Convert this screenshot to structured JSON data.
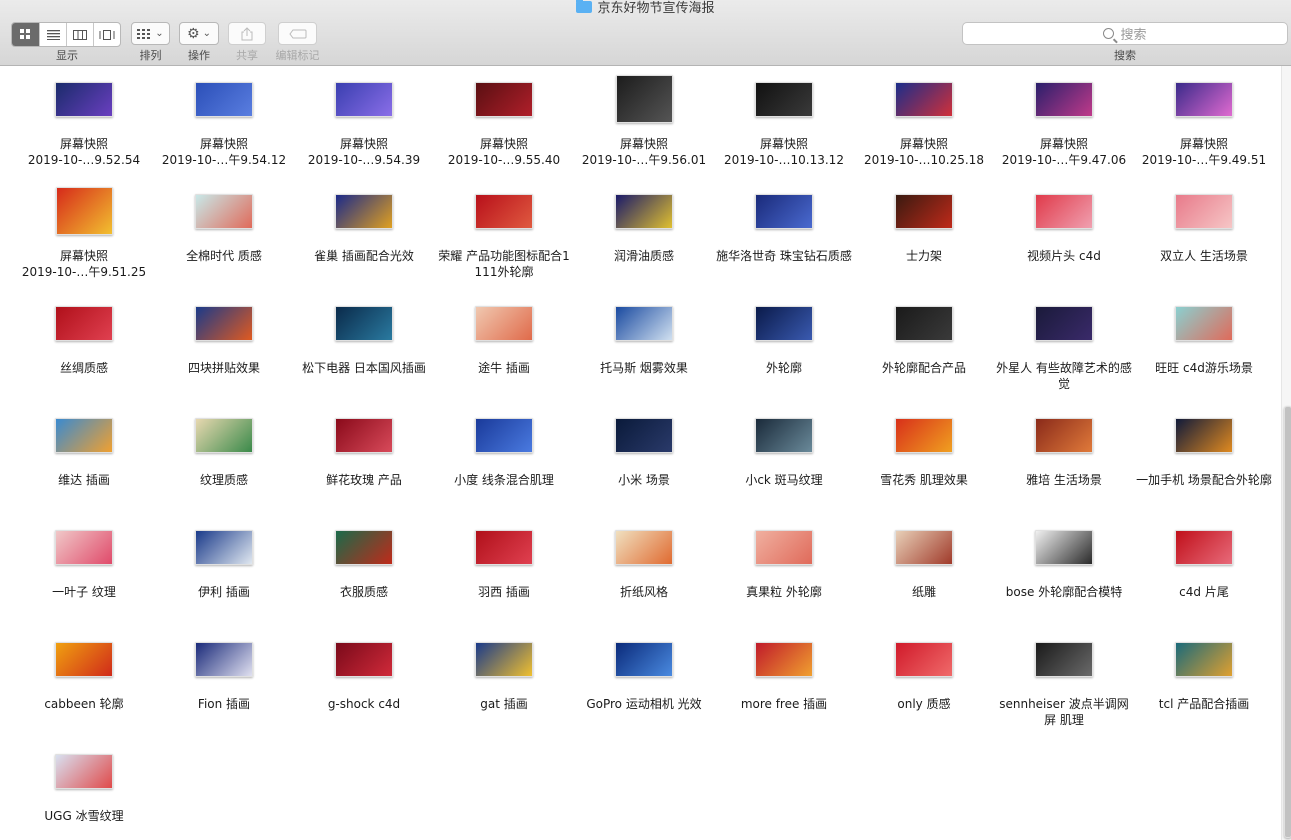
{
  "window": {
    "title": "京东好物节宣传海报"
  },
  "toolbar": {
    "view_label": "显示",
    "arrange_label": "排列",
    "action_label": "操作",
    "share_label": "共享",
    "tags_label": "编辑标记",
    "search_placeholder": "搜索",
    "search_label": "搜索"
  },
  "items": [
    {
      "name": "屏幕快照\n2019-10-…9.52.54",
      "colors": [
        "#1a2b6b",
        "#6a3fc0"
      ]
    },
    {
      "name": "屏幕快照\n2019-10-…午9.54.12",
      "colors": [
        "#2b4fb8",
        "#5a7ee0"
      ]
    },
    {
      "name": "屏幕快照\n2019-10-…9.54.39",
      "colors": [
        "#3a3fb0",
        "#8a6ee8"
      ]
    },
    {
      "name": "屏幕快照\n2019-10-…9.55.40",
      "colors": [
        "#5a0f12",
        "#b01f2a"
      ]
    },
    {
      "name": "屏幕快照\n2019-10-…午9.56.01",
      "colors": [
        "#1c1c1c",
        "#555555"
      ],
      "tall": true
    },
    {
      "name": "屏幕快照\n2019-10-…10.13.12",
      "colors": [
        "#111111",
        "#3a3a3a"
      ]
    },
    {
      "name": "屏幕快照\n2019-10-…10.25.18",
      "colors": [
        "#1b2d8a",
        "#d0303a"
      ]
    },
    {
      "name": "屏幕快照\n2019-10-…午9.47.06",
      "colors": [
        "#2a1f6b",
        "#c03a8a"
      ]
    },
    {
      "name": "屏幕快照\n2019-10-…午9.49.51",
      "colors": [
        "#3a2a8a",
        "#e06ad0"
      ]
    },
    {
      "name": "屏幕快照\n2019-10-…午9.51.25",
      "colors": [
        "#d62a1a",
        "#f2c030"
      ],
      "tall": true
    },
    {
      "name": "全棉时代 质感",
      "colors": [
        "#c8e8e8",
        "#e06a5a"
      ]
    },
    {
      "name": "雀巢 插画配合光效",
      "colors": [
        "#1b2a8a",
        "#e0a020"
      ]
    },
    {
      "name": "荣耀 产品功能图标配合1111外轮廓",
      "colors": [
        "#b8101a",
        "#e05a40"
      ]
    },
    {
      "name": "润滑油质感",
      "colors": [
        "#1a1a6a",
        "#e0c030"
      ]
    },
    {
      "name": "施华洛世奇 珠宝钻石质感",
      "colors": [
        "#1a2a7a",
        "#4a6ad0"
      ]
    },
    {
      "name": "士力架",
      "colors": [
        "#3a1a10",
        "#c02a1a"
      ]
    },
    {
      "name": "视频片头 c4d",
      "colors": [
        "#e03a4a",
        "#f0a0b0"
      ]
    },
    {
      "name": "双立人 生活场景",
      "colors": [
        "#e87a8a",
        "#f6c6c6"
      ]
    },
    {
      "name": "丝绸质感",
      "colors": [
        "#b0101a",
        "#e04050"
      ]
    },
    {
      "name": "四块拼贴效果",
      "colors": [
        "#1a3a8a",
        "#e05a20"
      ]
    },
    {
      "name": "松下电器 日本国风插画",
      "colors": [
        "#0a2a4a",
        "#2a7aa0"
      ]
    },
    {
      "name": "途牛 插画",
      "colors": [
        "#f0c8b0",
        "#e06a4a"
      ]
    },
    {
      "name": "托马斯 烟雾效果",
      "colors": [
        "#1a4aa0",
        "#d0e0f0"
      ]
    },
    {
      "name": "外轮廓",
      "colors": [
        "#0a1a4a",
        "#3a5ab0"
      ]
    },
    {
      "name": "外轮廓配合产品",
      "colors": [
        "#1a1a1a",
        "#3a3a3a"
      ]
    },
    {
      "name": "外星人 有些故障艺术的感觉",
      "colors": [
        "#1a1a3a",
        "#3a2a6a"
      ]
    },
    {
      "name": "旺旺 c4d游乐场景",
      "colors": [
        "#8ad0d0",
        "#e06a5a"
      ]
    },
    {
      "name": "维达  插画",
      "colors": [
        "#3a8ad0",
        "#f0a030"
      ]
    },
    {
      "name": "纹理质感",
      "colors": [
        "#e8d8b0",
        "#3a8a4a"
      ]
    },
    {
      "name": "鲜花玫瑰 产品",
      "colors": [
        "#8a0a1a",
        "#d84a5a"
      ]
    },
    {
      "name": "小度  线条混合肌理",
      "colors": [
        "#1a3a9a",
        "#4a7ae0"
      ]
    },
    {
      "name": "小米 场景",
      "colors": [
        "#0a1a3a",
        "#2a3a6a"
      ]
    },
    {
      "name": "小ck 斑马纹理",
      "colors": [
        "#1a2a3a",
        "#6a8a9a"
      ]
    },
    {
      "name": "雪花秀 肌理效果",
      "colors": [
        "#d8301a",
        "#f0a020"
      ]
    },
    {
      "name": "雅培 生活场景",
      "colors": [
        "#8a2a1a",
        "#e07a3a"
      ]
    },
    {
      "name": "一加手机 场景配合外轮廓",
      "colors": [
        "#101a3a",
        "#e08a20"
      ]
    },
    {
      "name": "一叶子 纹理",
      "colors": [
        "#f0c8c8",
        "#e04a6a"
      ]
    },
    {
      "name": "伊利  插画",
      "colors": [
        "#1a3a8a",
        "#e0e8f0"
      ]
    },
    {
      "name": "衣服质感",
      "colors": [
        "#1a6a4a",
        "#c02a1a"
      ]
    },
    {
      "name": "羽西 插画",
      "colors": [
        "#b0101a",
        "#e04050"
      ]
    },
    {
      "name": "折纸风格",
      "colors": [
        "#f0e0c0",
        "#e06a30"
      ]
    },
    {
      "name": "真果粒 外轮廓",
      "colors": [
        "#f0b0a0",
        "#e06a5a"
      ]
    },
    {
      "name": "纸雕",
      "colors": [
        "#e8d0b8",
        "#a03a2a"
      ]
    },
    {
      "name": "bose 外轮廓配合模特",
      "colors": [
        "#f0f0f0",
        "#2a2a2a"
      ]
    },
    {
      "name": "c4d 片尾",
      "colors": [
        "#c0101a",
        "#e86a7a"
      ]
    },
    {
      "name": "cabbeen 轮廓",
      "colors": [
        "#f0a010",
        "#d02a1a"
      ]
    },
    {
      "name": "Fion 插画",
      "colors": [
        "#1a2a7a",
        "#e0e0f0"
      ]
    },
    {
      "name": "g-shock c4d",
      "colors": [
        "#7a0a1a",
        "#d02a3a"
      ]
    },
    {
      "name": "gat 插画",
      "colors": [
        "#1a3a8a",
        "#f0c030"
      ]
    },
    {
      "name": "GoPro 运动相机 光效",
      "colors": [
        "#0a2a7a",
        "#4a8ae0"
      ]
    },
    {
      "name": "more free 插画",
      "colors": [
        "#c01a2a",
        "#f0a030"
      ]
    },
    {
      "name": "only 质感",
      "colors": [
        "#d01a2a",
        "#f06a6a"
      ]
    },
    {
      "name": "sennheiser  波点半调网屏  肌理",
      "colors": [
        "#1a1a1a",
        "#6a6a6a"
      ]
    },
    {
      "name": "tcl 产品配合插画",
      "colors": [
        "#1a6a7a",
        "#e0a030"
      ]
    },
    {
      "name": "UGG 冰雪纹理",
      "colors": [
        "#d8e0f0",
        "#e04a4a"
      ]
    }
  ]
}
